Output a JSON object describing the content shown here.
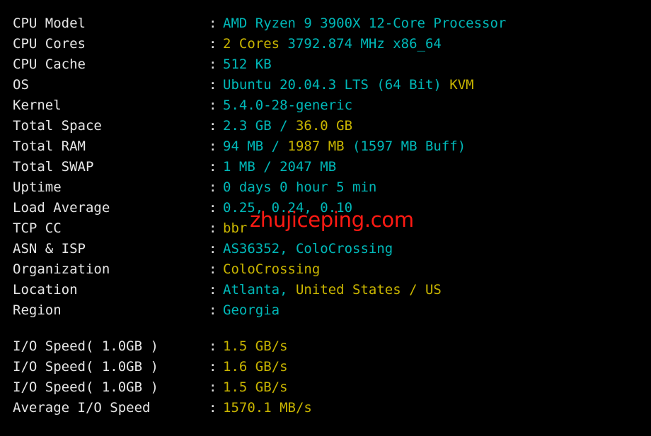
{
  "terminal": {
    "background_color": "#000000",
    "label_color": "#e6e6e6",
    "cyan_color": "#00b8b8",
    "yellow_color": "#c9b500",
    "watermark_color": "#ff1a13",
    "separator_text": "-------------------------------------------------------------------------------------------",
    "colon": ":"
  },
  "watermark": {
    "text": "zhujiceping.com"
  },
  "system_info": [
    {
      "label": "CPU Model",
      "segments": [
        {
          "text": "AMD Ryzen 9 3900X 12-Core Processor",
          "color": "cyan"
        }
      ]
    },
    {
      "label": "CPU Cores",
      "segments": [
        {
          "text": "2 Cores ",
          "color": "yellow"
        },
        {
          "text": "3792.874 MHz x86_64",
          "color": "cyan"
        }
      ]
    },
    {
      "label": "CPU Cache",
      "segments": [
        {
          "text": "512 KB",
          "color": "cyan"
        }
      ]
    },
    {
      "label": "OS",
      "segments": [
        {
          "text": "Ubuntu 20.04.3 LTS (64 Bit) ",
          "color": "cyan"
        },
        {
          "text": "KVM",
          "color": "yellow"
        }
      ]
    },
    {
      "label": "Kernel",
      "segments": [
        {
          "text": "5.4.0-28-generic",
          "color": "cyan"
        }
      ]
    },
    {
      "label": "Total Space",
      "segments": [
        {
          "text": "2.3 GB / ",
          "color": "cyan"
        },
        {
          "text": "36.0 GB",
          "color": "yellow"
        }
      ]
    },
    {
      "label": "Total RAM",
      "segments": [
        {
          "text": "94 MB / ",
          "color": "cyan"
        },
        {
          "text": "1987 MB ",
          "color": "yellow"
        },
        {
          "text": "(1597 MB Buff)",
          "color": "cyan"
        }
      ]
    },
    {
      "label": "Total SWAP",
      "segments": [
        {
          "text": "1 MB / 2047 MB",
          "color": "cyan"
        }
      ]
    },
    {
      "label": "Uptime",
      "segments": [
        {
          "text": "0 days 0 hour 5 min",
          "color": "cyan"
        }
      ]
    },
    {
      "label": "Load Average",
      "segments": [
        {
          "text": "0.25, 0.24, 0.10",
          "color": "cyan"
        }
      ]
    },
    {
      "label": "TCP CC",
      "segments": [
        {
          "text": "bbr",
          "color": "yellow"
        }
      ]
    },
    {
      "label": "ASN & ISP",
      "segments": [
        {
          "text": "AS36352, ColoCrossing",
          "color": "cyan"
        }
      ]
    },
    {
      "label": "Organization",
      "segments": [
        {
          "text": "ColoCrossing",
          "color": "yellow"
        }
      ]
    },
    {
      "label": "Location",
      "segments": [
        {
          "text": "Atlanta, ",
          "color": "cyan"
        },
        {
          "text": "United States / US",
          "color": "yellow"
        }
      ]
    },
    {
      "label": "Region",
      "segments": [
        {
          "text": "Georgia",
          "color": "cyan"
        }
      ]
    }
  ],
  "io_results": [
    {
      "label": "I/O Speed( 1.0GB )",
      "segments": [
        {
          "text": "1.5 GB/s",
          "color": "yellow"
        }
      ]
    },
    {
      "label": "I/O Speed( 1.0GB )",
      "segments": [
        {
          "text": "1.6 GB/s",
          "color": "yellow"
        }
      ]
    },
    {
      "label": "I/O Speed( 1.0GB )",
      "segments": [
        {
          "text": "1.5 GB/s",
          "color": "yellow"
        }
      ]
    },
    {
      "label": "Average I/O Speed",
      "segments": [
        {
          "text": "1570.1 MB/s",
          "color": "yellow"
        }
      ]
    }
  ]
}
